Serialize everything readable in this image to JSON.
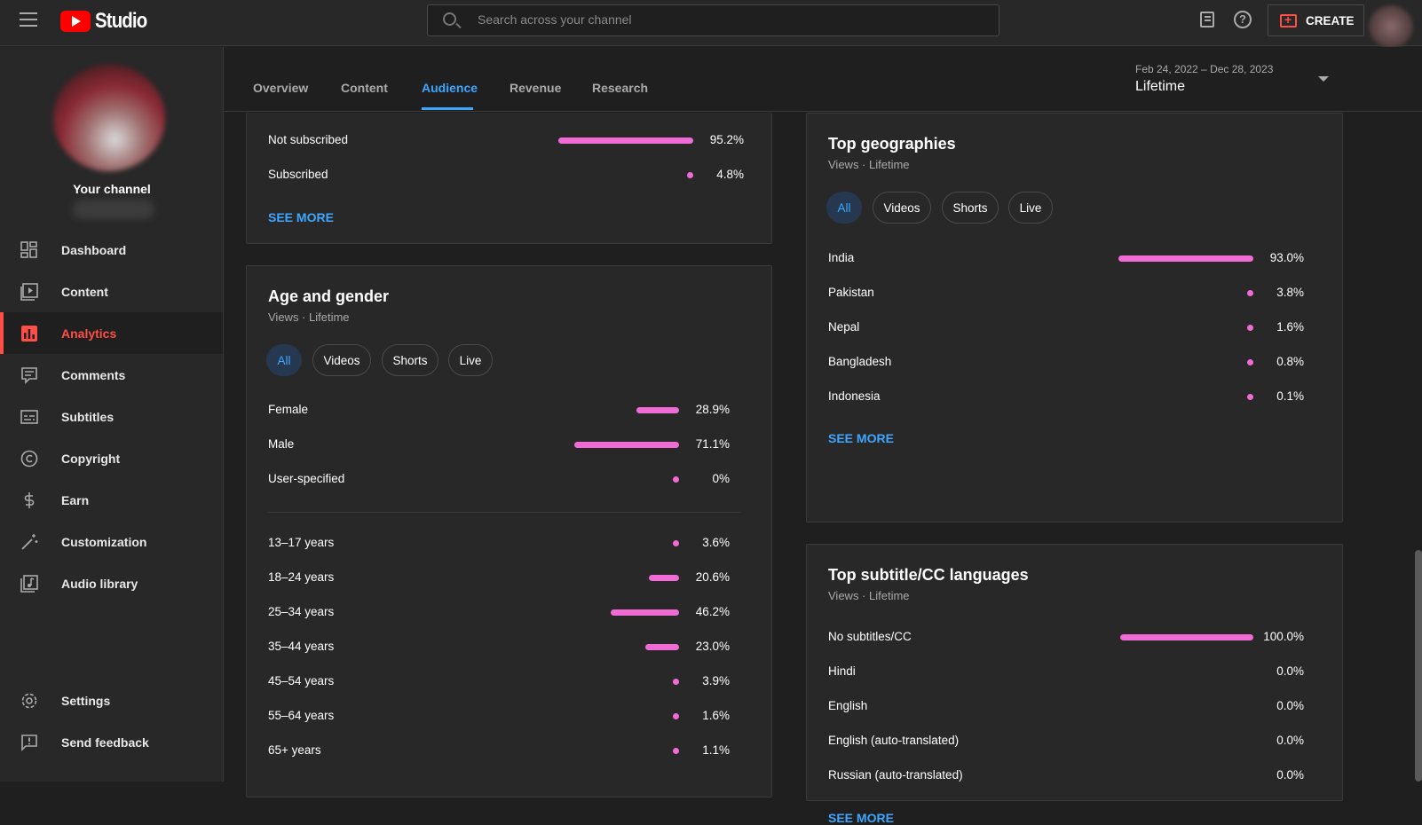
{
  "header": {
    "logo_text": "Studio",
    "search_placeholder": "Search across your channel",
    "create_label": "CREATE",
    "help_glyph": "?"
  },
  "sidebar": {
    "channel_label": "Your channel",
    "items": [
      {
        "label": "Dashboard",
        "icon": "dashboard-icon"
      },
      {
        "label": "Content",
        "icon": "content-icon"
      },
      {
        "label": "Analytics",
        "icon": "analytics-icon",
        "active": true
      },
      {
        "label": "Comments",
        "icon": "comments-icon"
      },
      {
        "label": "Subtitles",
        "icon": "subtitles-icon"
      },
      {
        "label": "Copyright",
        "icon": "copyright-icon"
      },
      {
        "label": "Earn",
        "icon": "earn-icon"
      },
      {
        "label": "Customization",
        "icon": "customization-icon"
      },
      {
        "label": "Audio library",
        "icon": "audio-library-icon"
      },
      {
        "label": "Settings",
        "icon": "settings-icon"
      },
      {
        "label": "Send feedback",
        "icon": "feedback-icon"
      }
    ]
  },
  "tabs": {
    "items": [
      "Overview",
      "Content",
      "Audience",
      "Revenue",
      "Research"
    ],
    "active": "Audience"
  },
  "date": {
    "range": "Feb 24, 2022 – Dec 28, 2023",
    "label": "Lifetime"
  },
  "subscription": {
    "rows": [
      {
        "label": "Not subscribed",
        "value": 95.2,
        "pct": "95.2%"
      },
      {
        "label": "Subscribed",
        "value": 4.8,
        "pct": "4.8%"
      }
    ],
    "see_more": "SEE MORE"
  },
  "age_gender": {
    "title": "Age and gender",
    "subtitle": "Views · Lifetime",
    "chips": [
      "All",
      "Videos",
      "Shorts",
      "Live"
    ],
    "gender_rows": [
      {
        "label": "Female",
        "value": 28.9,
        "pct": "28.9%"
      },
      {
        "label": "Male",
        "value": 71.1,
        "pct": "71.1%"
      },
      {
        "label": "User-specified",
        "value": 0,
        "pct": "0%"
      }
    ],
    "age_rows": [
      {
        "label": "13–17 years",
        "value": 3.6,
        "pct": "3.6%"
      },
      {
        "label": "18–24 years",
        "value": 20.6,
        "pct": "20.6%"
      },
      {
        "label": "25–34 years",
        "value": 46.2,
        "pct": "46.2%"
      },
      {
        "label": "35–44 years",
        "value": 23.0,
        "pct": "23.0%"
      },
      {
        "label": "45–54 years",
        "value": 3.9,
        "pct": "3.9%"
      },
      {
        "label": "55–64 years",
        "value": 1.6,
        "pct": "1.6%"
      },
      {
        "label": "65+ years",
        "value": 1.1,
        "pct": "1.1%"
      }
    ]
  },
  "geographies": {
    "title": "Top geographies",
    "subtitle": "Views · Lifetime",
    "chips": [
      "All",
      "Videos",
      "Shorts",
      "Live"
    ],
    "rows": [
      {
        "label": "India",
        "value": 93.0,
        "pct": "93.0%"
      },
      {
        "label": "Pakistan",
        "value": 3.8,
        "pct": "3.8%"
      },
      {
        "label": "Nepal",
        "value": 1.6,
        "pct": "1.6%"
      },
      {
        "label": "Bangladesh",
        "value": 0.8,
        "pct": "0.8%"
      },
      {
        "label": "Indonesia",
        "value": 0.1,
        "pct": "0.1%"
      }
    ],
    "see_more": "SEE MORE"
  },
  "subtitles_card": {
    "title": "Top subtitle/CC languages",
    "subtitle": "Views · Lifetime",
    "rows": [
      {
        "label": "No subtitles/CC",
        "value": 100.0,
        "pct": "100.0%"
      },
      {
        "label": "Hindi",
        "value": 0,
        "pct": "0.0%"
      },
      {
        "label": "English",
        "value": 0,
        "pct": "0.0%"
      },
      {
        "label": "English (auto-translated)",
        "value": 0,
        "pct": "0.0%"
      },
      {
        "label": "Russian (auto-translated)",
        "value": 0,
        "pct": "0.0%"
      }
    ],
    "see_more": "SEE MORE"
  },
  "colors": {
    "accent": "#3ea6ff",
    "bar": "#f06bd4",
    "brand": "#ff0000",
    "active_nav": "#ff4e45"
  }
}
